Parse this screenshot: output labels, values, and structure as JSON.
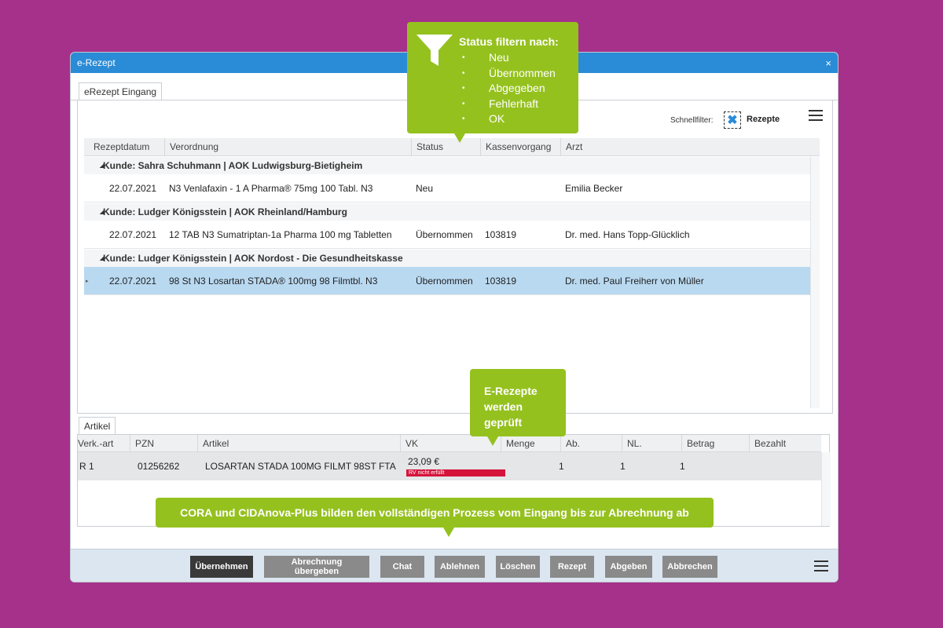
{
  "window": {
    "title": "e-Rezept",
    "close": "×"
  },
  "tabs": {
    "main": "eRezept Eingang",
    "artikel": "Artikel"
  },
  "schnellfilter": {
    "label": "Schnellfilter:",
    "value": "Rezepte"
  },
  "grid": {
    "headers": [
      "Rezeptdatum",
      "Verordnung",
      "Status",
      "Kassenvorgang",
      "Arzt"
    ],
    "groups": [
      {
        "title": "Kunde: Sahra Schuhmann | AOK Ludwigsburg-Bietigheim",
        "row": {
          "datum": "22.07.2021",
          "verordnung": "N3 Venlafaxin - 1 A Pharma® 75mg 100 Tabl. N3",
          "status": "Neu",
          "kassenvorgang": "",
          "arzt": "Emilia Becker"
        }
      },
      {
        "title": "Kunde: Ludger Königsstein | AOK Rheinland/Hamburg",
        "row": {
          "datum": "22.07.2021",
          "verordnung": "12 TAB N3 Sumatriptan-1a Pharma 100 mg Tabletten",
          "status": "Übernommen",
          "kassenvorgang": "103819",
          "arzt": "Dr. med. Hans Topp-Glücklich"
        }
      },
      {
        "title": "Kunde: Ludger Königsstein | AOK Nordost - Die Gesundheitskasse",
        "row": {
          "datum": "22.07.2021",
          "verordnung": "98 St N3 Losartan STADA® 100mg 98 Filmtbl. N3",
          "status": "Übernommen",
          "kassenvorgang": "103819",
          "arzt": "Dr. med. Paul Freiherr von Müller"
        }
      }
    ]
  },
  "artikel": {
    "headers": [
      "Verk.-art",
      "PZN",
      "Artikel",
      "VK",
      "Menge",
      "Ab.",
      "NL.",
      "Betrag",
      "Bezahlt"
    ],
    "row": {
      "verkart": "R 1",
      "pzn": "01256262",
      "artikel": "LOSARTAN STADA 100MG FILMT 98ST FTA",
      "vk": "23,09 €",
      "badge": "RV nicht erfüllt",
      "menge": "1",
      "ab": "1",
      "nl": "1"
    }
  },
  "buttons": [
    "Übernehmen",
    "Abrechnung übergeben",
    "Chat",
    "Ablehnen",
    "Löschen",
    "Rezept",
    "Abgeben",
    "Abbrechen"
  ],
  "callouts": {
    "filter_title": "Status filtern nach:",
    "filter_items": [
      "Neu",
      "Übernommen",
      "Abgegeben",
      "Fehlerhaft",
      "OK"
    ],
    "check": "E-Rezepte werden geprüft",
    "bottom": "CORA und CIDAnova-Plus bilden den vollständigen Prozess vom Eingang bis zur Abrechnung ab"
  },
  "colors": {
    "background": "#a5318b",
    "callout": "#95c11f",
    "titlebar": "#2a8bd6",
    "selection": "#b9d9f1",
    "badge": "#d5143c"
  },
  "icons": {
    "filter": "funnel-icon",
    "close": "close-icon",
    "menu": "hamburger-menu-icon",
    "schnellfilter-clear": "x-checkbox-icon"
  }
}
